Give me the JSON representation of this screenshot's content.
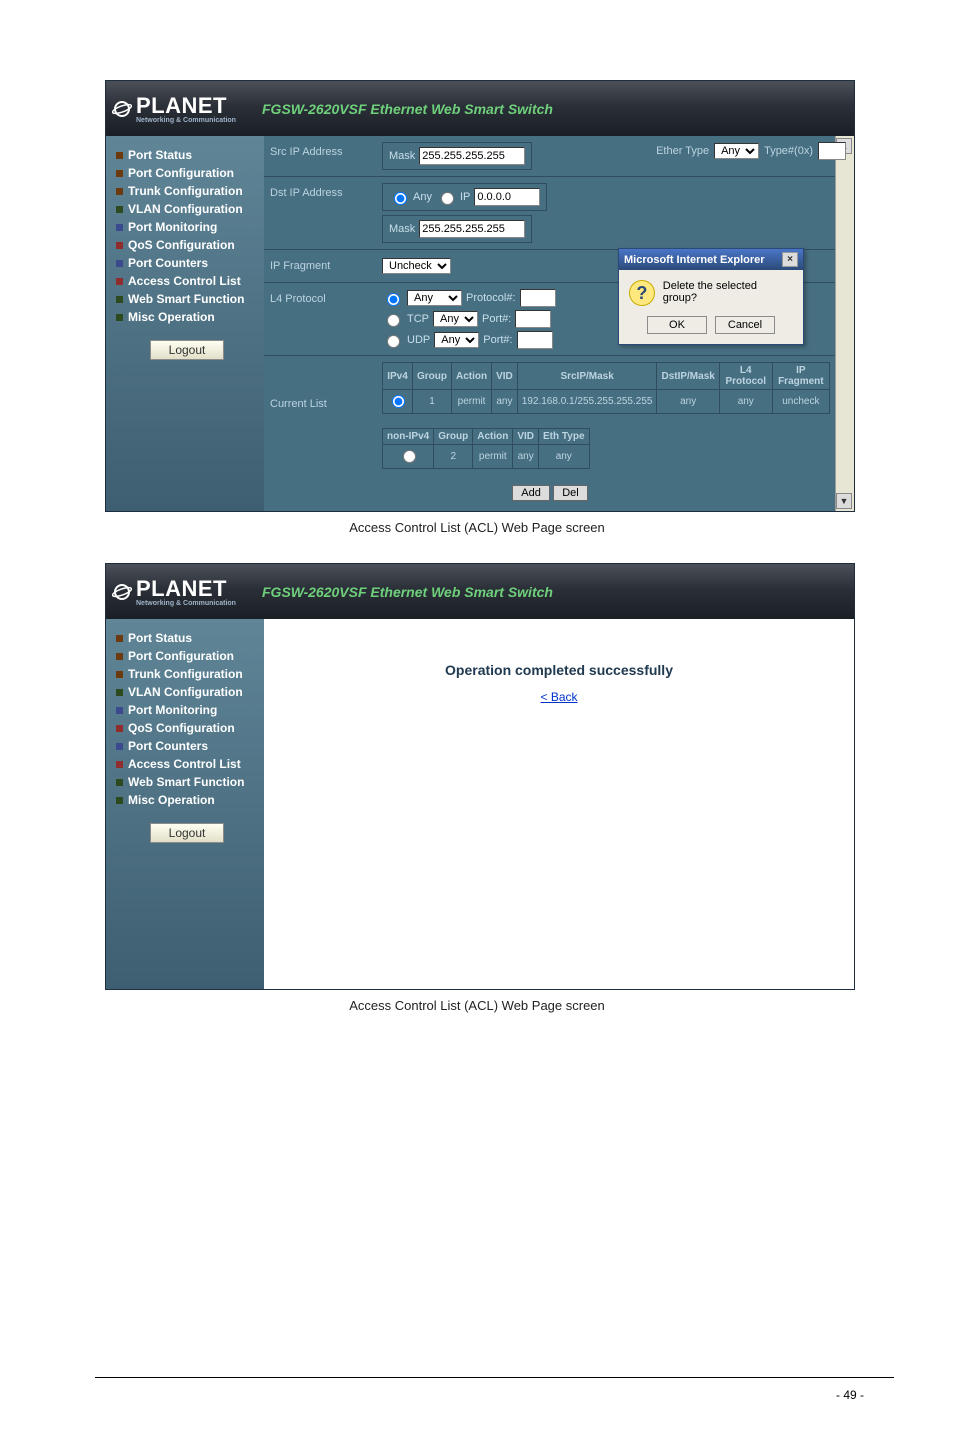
{
  "doc": {
    "caption1": "Access Control List (ACL) Web Page screen",
    "caption2": "Access Control List (ACL) Web Page screen",
    "page_number": "- 49 -"
  },
  "app": {
    "brand": "PLANET",
    "brand_sub": "Networking & Communication",
    "product": "FGSW-2620VSF Ethernet Web Smart Switch",
    "logout": "Logout"
  },
  "sidebar": {
    "items": [
      {
        "label": "Port Status"
      },
      {
        "label": "Port Configuration"
      },
      {
        "label": "Trunk Configuration"
      },
      {
        "label": "VLAN Configuration"
      },
      {
        "label": "Port Monitoring"
      },
      {
        "label": "QoS Configuration"
      },
      {
        "label": "Port Counters"
      },
      {
        "label": "Access Control List"
      },
      {
        "label": "Web Smart Function"
      },
      {
        "label": "Misc Operation"
      }
    ]
  },
  "acl_form": {
    "src_ip_label": "Src IP Address",
    "dst_ip_label": "Dst IP Address",
    "ip_fragment_label": "IP Fragment",
    "l4_protocol_label": "L4 Protocol",
    "current_list_label": "Current List",
    "mask_label": "Mask",
    "mask_value": "255.255.255.255",
    "any_option": "Any",
    "ip_option": "IP",
    "dst_ip_value": "0.0.0.0",
    "uncheck_option": "Uncheck",
    "l4_any_option": "Any",
    "l4_tcp_option": "TCP",
    "l4_udp_option": "UDP",
    "protocol_hash": "Protocol#:",
    "port_hash": "Port#:",
    "ether_type_label": "Ether Type",
    "ether_any": "Any",
    "type_num": "Type#(0x)",
    "add_btn": "Add",
    "del_btn": "Del"
  },
  "ipv4_table": {
    "headers": [
      "IPv4",
      "Group",
      "Action",
      "VID",
      "SrcIP/Mask",
      "DstIP/Mask",
      "L4 Protocol",
      "IP Fragment"
    ],
    "row": {
      "group": "1",
      "action": "permit",
      "vid": "any",
      "src": "192.168.0.1/255.255.255.255",
      "dst": "any",
      "l4": "any",
      "frag": "uncheck"
    }
  },
  "non_ipv4_table": {
    "headers": [
      "non-IPv4",
      "Group",
      "Action",
      "VID",
      "Eth Type"
    ],
    "row": {
      "group": "2",
      "action": "permit",
      "vid": "any",
      "eth": "any"
    }
  },
  "dialog": {
    "title": "Microsoft Internet Explorer",
    "message": "Delete the selected group?",
    "ok": "OK",
    "cancel": "Cancel"
  },
  "success": {
    "heading": "Operation completed successfully",
    "back": "< Back"
  }
}
